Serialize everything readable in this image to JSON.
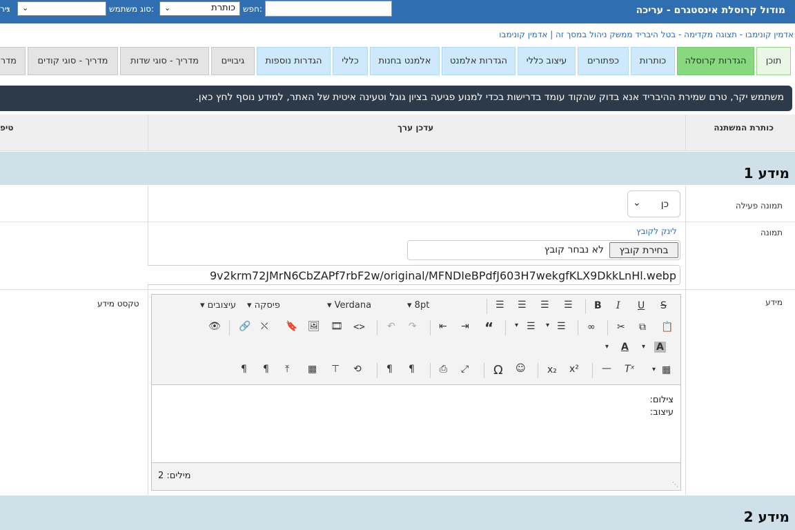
{
  "header": {
    "title": "מודול קרוסלת אינסטגרם - עריכה",
    "search_label": "חפש:",
    "search_value": "",
    "field_select_value": "כותרת",
    "user_type_label": "סוג משתמש:",
    "user_type_value": "",
    "cut_label": "גיר"
  },
  "breadcrumb": "אדמין קונימבו - תצוגה מקדימה - בטל היבריד ממשק ניהול במסך זה | אדמין קונימבו",
  "tabs": [
    "תוכן",
    "הגדרות קרוסלה",
    "כותרות",
    "כפתורים",
    "עיצוב כללי",
    "הגדרות אלמנט",
    "אלמנט בחנות",
    "כללי",
    "הגדרות נוספות",
    "גיבויים",
    "מדריך - סוגי שדות",
    "מדריך - סוגי קודים",
    "מדריך"
  ],
  "notice": "משתמש יקר, טרם שמירת ההיבריד אנא בדוק שהקוד עומד בדרישות בכדי למנוע פגיעה בציון גוגל וטעינה איטית של האתר, למידע נוסף לחץ כאן.",
  "table": {
    "col_var_title": "כותרת המשתנה",
    "col_value_editor": "עדכן ערך",
    "col_tip": "טיפ"
  },
  "section1": {
    "title": "מידע 1",
    "active_image_label": "תמונה פעילה",
    "active_image_value": "כן",
    "image_label": "תמונה",
    "file_link": "לינק לקובץ",
    "choose_file_button": "בחירת קובץ",
    "no_file_text": "לא נבחר קובץ",
    "url_value": "9v2krm72JMrN6CbZAPf7rbF2w/original/MFNDIeBPdfJ603H7wekgfKLX9DkkLnHl.webp",
    "info_label": "מידע",
    "info_tip": "טקסט מידע",
    "editor": {
      "styles_label": "עיצובים",
      "paragraph_label": "פיסקה",
      "font_label": "Verdana",
      "size_label": "8pt",
      "lines": [
        "צילום:",
        "עיצוב:"
      ],
      "word_count": "מילים: 2"
    }
  },
  "section2": {
    "title": "מידע 2"
  }
}
